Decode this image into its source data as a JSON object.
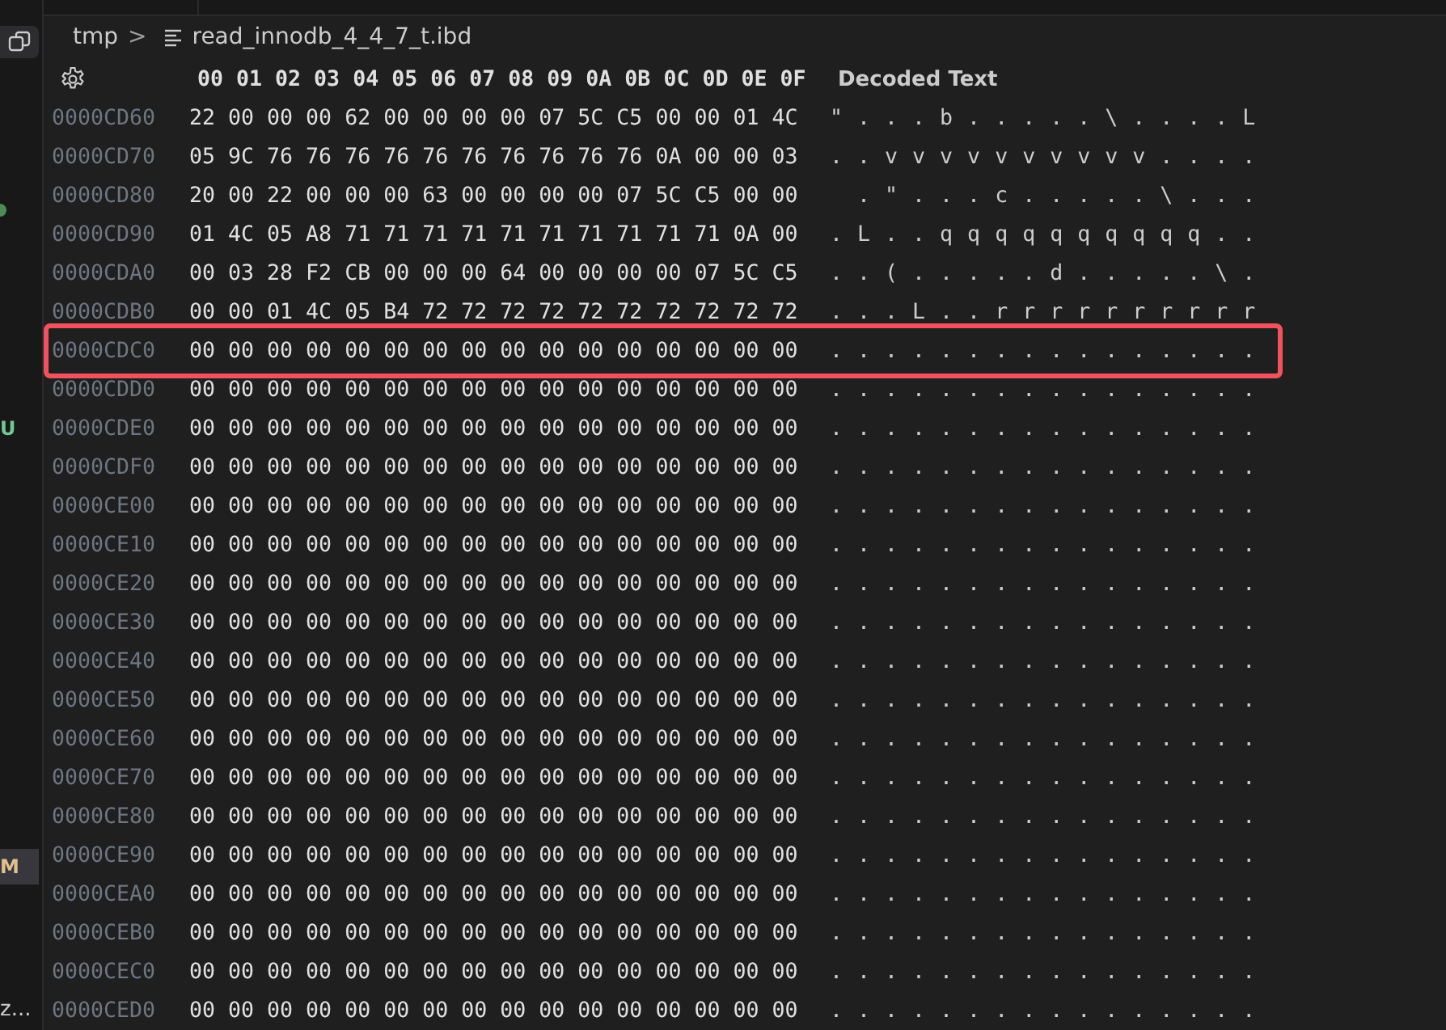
{
  "sidebar": {
    "items": [
      {
        "kind": "icon",
        "selected": true
      },
      {
        "kind": "dot",
        "color": "#4d8a57"
      },
      {
        "kind": "letter",
        "text": "U",
        "color": "#73c991",
        "selected": false
      },
      {
        "kind": "letter",
        "text": "M",
        "color": "#e2c08d",
        "selected": true
      },
      {
        "kind": "text",
        "text": "z..."
      }
    ]
  },
  "breadcrumb": {
    "folder": "tmp",
    "separator": ">",
    "file": "read_innodb_4_4_7_t.ibd"
  },
  "hex_view": {
    "header": {
      "bytes": "00 01 02 03 04 05 06 07 08 09 0A 0B 0C 0D 0E 0F",
      "decoded": "Decoded Text"
    },
    "rows": [
      {
        "offset": "0000CD60",
        "bytes": "22 00 00 00 62 00 00 00 00 07 5C C5 00 00 01 4C",
        "decoded": "\" . . . b . . . . . \\ . . . . L",
        "highlighted": false
      },
      {
        "offset": "0000CD70",
        "bytes": "05 9C 76 76 76 76 76 76 76 76 76 76 0A 00 00 03",
        "decoded": ". . v v v v v v v v v v . . . .",
        "highlighted": false
      },
      {
        "offset": "0000CD80",
        "bytes": "20 00 22 00 00 00 63 00 00 00 00 07 5C C5 00 00",
        "decoded": "  . \" . . . c . . . . . \\ . . .",
        "highlighted": false
      },
      {
        "offset": "0000CD90",
        "bytes": "01 4C 05 A8 71 71 71 71 71 71 71 71 71 71 0A 00",
        "decoded": ". L . . q q q q q q q q q q . .",
        "highlighted": false
      },
      {
        "offset": "0000CDA0",
        "bytes": "00 03 28 F2 CB 00 00 00 64 00 00 00 00 07 5C C5",
        "decoded": ". . ( . . . . . d . . . . . \\ .",
        "highlighted": false
      },
      {
        "offset": "0000CDB0",
        "bytes": "00 00 01 4C 05 B4 72 72 72 72 72 72 72 72 72 72",
        "decoded": ". . . L . . r r r r r r r r r r",
        "highlighted": false
      },
      {
        "offset": "0000CDC0",
        "bytes": "00 00 00 00 00 00 00 00 00 00 00 00 00 00 00 00",
        "decoded": ". . . . . . . . . . . . . . . .",
        "highlighted": true
      },
      {
        "offset": "0000CDD0",
        "bytes": "00 00 00 00 00 00 00 00 00 00 00 00 00 00 00 00",
        "decoded": ". . . . . . . . . . . . . . . .",
        "highlighted": false
      },
      {
        "offset": "0000CDE0",
        "bytes": "00 00 00 00 00 00 00 00 00 00 00 00 00 00 00 00",
        "decoded": ". . . . . . . . . . . . . . . .",
        "highlighted": false
      },
      {
        "offset": "0000CDF0",
        "bytes": "00 00 00 00 00 00 00 00 00 00 00 00 00 00 00 00",
        "decoded": ". . . . . . . . . . . . . . . .",
        "highlighted": false
      },
      {
        "offset": "0000CE00",
        "bytes": "00 00 00 00 00 00 00 00 00 00 00 00 00 00 00 00",
        "decoded": ". . . . . . . . . . . . . . . .",
        "highlighted": false
      },
      {
        "offset": "0000CE10",
        "bytes": "00 00 00 00 00 00 00 00 00 00 00 00 00 00 00 00",
        "decoded": ". . . . . . . . . . . . . . . .",
        "highlighted": false
      },
      {
        "offset": "0000CE20",
        "bytes": "00 00 00 00 00 00 00 00 00 00 00 00 00 00 00 00",
        "decoded": ". . . . . . . . . . . . . . . .",
        "highlighted": false
      },
      {
        "offset": "0000CE30",
        "bytes": "00 00 00 00 00 00 00 00 00 00 00 00 00 00 00 00",
        "decoded": ". . . . . . . . . . . . . . . .",
        "highlighted": false
      },
      {
        "offset": "0000CE40",
        "bytes": "00 00 00 00 00 00 00 00 00 00 00 00 00 00 00 00",
        "decoded": ". . . . . . . . . . . . . . . .",
        "highlighted": false
      },
      {
        "offset": "0000CE50",
        "bytes": "00 00 00 00 00 00 00 00 00 00 00 00 00 00 00 00",
        "decoded": ". . . . . . . . . . . . . . . .",
        "highlighted": false
      },
      {
        "offset": "0000CE60",
        "bytes": "00 00 00 00 00 00 00 00 00 00 00 00 00 00 00 00",
        "decoded": ". . . . . . . . . . . . . . . .",
        "highlighted": false
      },
      {
        "offset": "0000CE70",
        "bytes": "00 00 00 00 00 00 00 00 00 00 00 00 00 00 00 00",
        "decoded": ". . . . . . . . . . . . . . . .",
        "highlighted": false
      },
      {
        "offset": "0000CE80",
        "bytes": "00 00 00 00 00 00 00 00 00 00 00 00 00 00 00 00",
        "decoded": ". . . . . . . . . . . . . . . .",
        "highlighted": false
      },
      {
        "offset": "0000CE90",
        "bytes": "00 00 00 00 00 00 00 00 00 00 00 00 00 00 00 00",
        "decoded": ". . . . . . . . . . . . . . . .",
        "highlighted": false
      },
      {
        "offset": "0000CEA0",
        "bytes": "00 00 00 00 00 00 00 00 00 00 00 00 00 00 00 00",
        "decoded": ". . . . . . . . . . . . . . . .",
        "highlighted": false
      },
      {
        "offset": "0000CEB0",
        "bytes": "00 00 00 00 00 00 00 00 00 00 00 00 00 00 00 00",
        "decoded": ". . . . . . . . . . . . . . . .",
        "highlighted": false
      },
      {
        "offset": "0000CEC0",
        "bytes": "00 00 00 00 00 00 00 00 00 00 00 00 00 00 00 00",
        "decoded": ". . . . . . . . . . . . . . . .",
        "highlighted": false
      },
      {
        "offset": "0000CED0",
        "bytes": "00 00 00 00 00 00 00 00 00 00 00 00 00 00 00 00",
        "decoded": ". . . . . . . . . . . . . . . .",
        "highlighted": false
      }
    ]
  }
}
